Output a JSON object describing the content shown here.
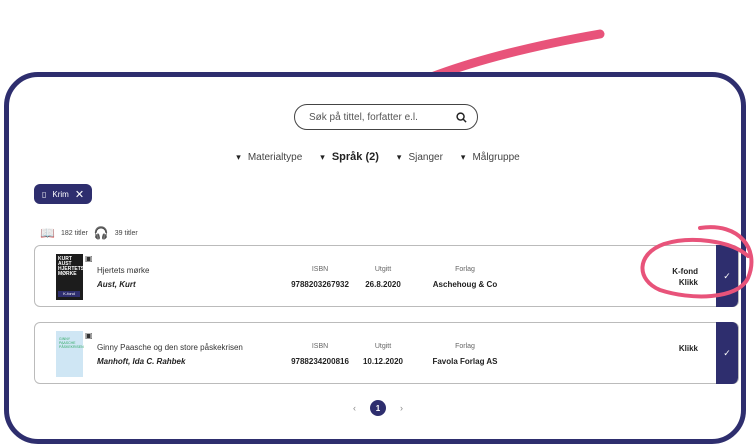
{
  "search": {
    "placeholder": "Søk på tittel, forfatter e.l."
  },
  "filters": [
    {
      "label": "Materialtype",
      "active": false
    },
    {
      "label": "Språk (2)",
      "active": true
    },
    {
      "label": "Sjanger",
      "active": false
    },
    {
      "label": "Målgruppe",
      "active": false
    }
  ],
  "active_chip": {
    "label": "Krim"
  },
  "counts": {
    "books": "182 titler",
    "audio": "39 titler"
  },
  "columns": {
    "isbn": "ISBN",
    "date": "Utgitt",
    "publisher": "Forlag"
  },
  "results": [
    {
      "title": "Hjertets mørke",
      "author": "Aust, Kurt",
      "isbn": "9788203267932",
      "date": "26.8.2020",
      "publisher": "Aschehoug & Co",
      "tags": [
        "K-fond",
        "Klikk"
      ],
      "cover_text": "KURT AUST HJERTETS MØRKE",
      "cover_badge": "K-fond"
    },
    {
      "title": "Ginny Paasche og den store påskekrisen",
      "author": "Manhoft, Ida C. Rahbek",
      "isbn": "9788234200816",
      "date": "10.12.2020",
      "publisher": "Favola Forlag AS",
      "tags": [
        "Klikk"
      ],
      "cover_text": "GINNY PAASCHE PÅSKEKRISEN"
    }
  ],
  "pagination": {
    "current": "1",
    "prev": "‹",
    "next": "›"
  },
  "colors": {
    "accent": "#2e2e6e",
    "annotation": "#e8537a"
  }
}
